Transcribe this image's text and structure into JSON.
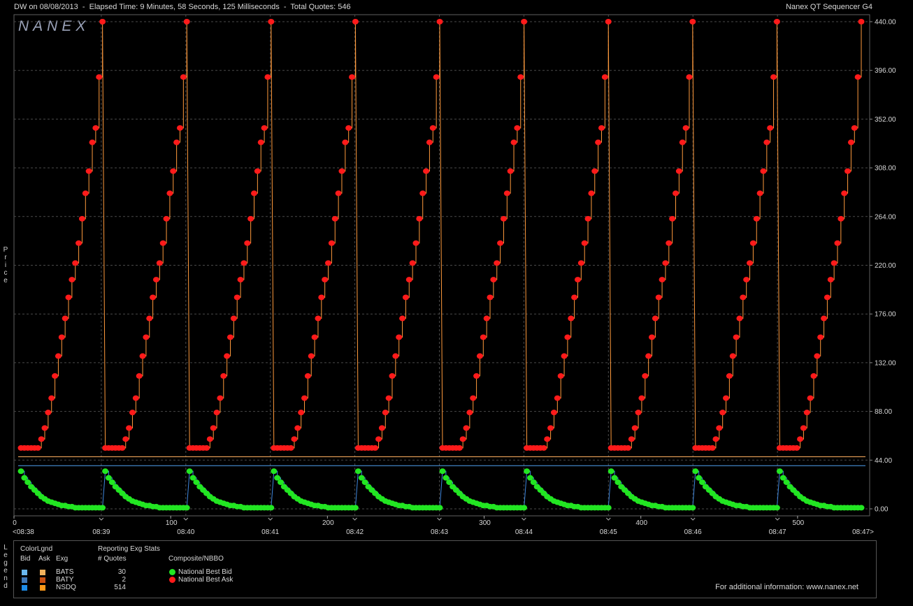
{
  "header": {
    "title": "DW on 08/08/2013  -  Elapsed Time: 9 Minutes, 58 Seconds, 125 Milliseconds  -  Total Quotes: 546",
    "app_name": "Nanex QT Sequencer G4"
  },
  "watermark": "NANEX",
  "side_labels": {
    "price": [
      "P",
      "r",
      "i",
      "c",
      "e"
    ],
    "legend": [
      "L",
      "e",
      "g",
      "e",
      "n",
      "d"
    ]
  },
  "colors": {
    "ask_line": "#ff9a3c",
    "ask_marker": "#ff1a1a",
    "bid_line": "#3f88e0",
    "bid_marker": "#22e622",
    "grid": "#4a4a4a",
    "axis_text": "#d8d8d8"
  },
  "chart_data": {
    "type": "line",
    "title": "",
    "xlabel": "",
    "ylabel": "Price",
    "ylim": [
      -6,
      440
    ],
    "y_ticks": [
      "440.00",
      "396.00",
      "352.00",
      "308.00",
      "264.00",
      "220.00",
      "176.00",
      "132.00",
      "88.00",
      "44.00",
      "0.00"
    ],
    "time_ticks": [
      "<08:38",
      "08:39",
      "08:40",
      "08:41",
      "08:42",
      "08:43",
      "08:44",
      "08:45",
      "08:46",
      "08:47",
      "08:47>"
    ],
    "quote_ticks": [
      "0",
      "100",
      "200",
      "300",
      "400",
      "500"
    ],
    "quote_range": [
      0,
      546
    ],
    "cycle_count": 10,
    "cycle_steps": 25,
    "series": [
      {
        "name": "National Best Ask",
        "cycle_prices": [
          55,
          55,
          55,
          55,
          55,
          55,
          63,
          73,
          87,
          100,
          120,
          138,
          155,
          172,
          191,
          207,
          222,
          240,
          262,
          285,
          305,
          331,
          344,
          390,
          440
        ]
      },
      {
        "name": "National Best Bid",
        "cycle_prices": [
          34,
          28,
          24,
          20,
          17,
          14,
          11,
          9,
          7,
          6,
          5,
          4,
          3,
          3,
          2,
          2,
          1,
          1,
          1,
          1,
          1,
          1,
          1,
          1,
          1
        ]
      }
    ],
    "reference_lines": [
      {
        "name": "Ask reference",
        "value": 47
      },
      {
        "name": "Bid reference",
        "value": 39
      }
    ]
  },
  "legend": {
    "color_legend_title": "ColorLgnd",
    "col_bid": "Bid",
    "col_ask": "Ask",
    "col_exg": "Exg",
    "stats_title": "Reporting Exg Stats",
    "stats_col": "# Quotes",
    "composite_title": "Composite/NBBO",
    "exchanges": [
      {
        "name": "BATS",
        "quotes": "30",
        "bid_color": "#6ab8f0",
        "ask_color": "#f2b25c"
      },
      {
        "name": "BATY",
        "quotes": "2",
        "bid_color": "#3e78b8",
        "ask_color": "#c85010"
      },
      {
        "name": "NSDQ",
        "quotes": "514",
        "bid_color": "#1e8ce8",
        "ask_color": "#ff9a1a"
      }
    ],
    "composite": [
      {
        "name": "National Best Bid",
        "color": "#22e622"
      },
      {
        "name": "National Best Ask",
        "color": "#ff1a1a"
      }
    ],
    "info": "For additional information: www.nanex.net"
  }
}
